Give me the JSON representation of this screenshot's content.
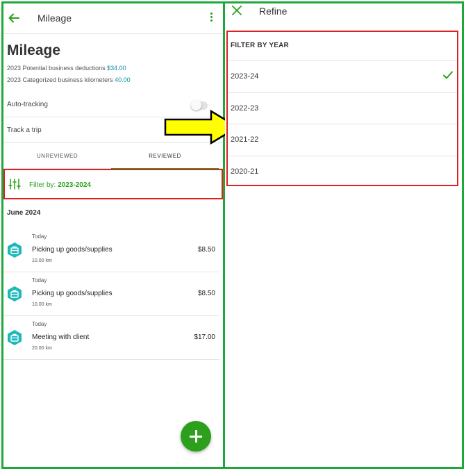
{
  "left": {
    "topbar_title": "Mileage",
    "page_title": "Mileage",
    "summary": {
      "deductions_label": "2023 Potential business deductions",
      "deductions_value": "$34.00",
      "km_label": "2023 Categorized business kilometers",
      "km_value": "40.00"
    },
    "auto_tracking_label": "Auto-tracking",
    "auto_tracking_on": false,
    "track_trip_label": "Track a trip",
    "tabs": {
      "unreviewed": "UNREVIEWED",
      "reviewed": "REVIEWED"
    },
    "filter": {
      "label": "Filter by:",
      "value": "2023-2024"
    },
    "month": "June 2024",
    "trips": [
      {
        "date": "Today",
        "name": "Picking up goods/supplies",
        "distance": "10.00 km",
        "amount": "$8.50"
      },
      {
        "date": "Today",
        "name": "Picking up goods/supplies",
        "distance": "10.00 km",
        "amount": "$8.50"
      },
      {
        "date": "Today",
        "name": "Meeting with client",
        "distance": "20.00 km",
        "amount": "$17.00"
      }
    ]
  },
  "right": {
    "title": "Refine",
    "filter_header": "FILTER BY YEAR",
    "years": [
      "2023-24",
      "2022-23",
      "2021-22",
      "2020-21"
    ],
    "selected_year": "2023-24"
  },
  "colors": {
    "brand_green": "#2ca01c",
    "teal": "#0b8ea8",
    "highlight_red": "#e02020",
    "frame_green": "#1fa83a",
    "arrow_yellow": "#ffff00"
  },
  "icons": {
    "back": "arrow-left-icon",
    "menu": "kebab-menu-icon",
    "filter": "sliders-icon",
    "trip": "briefcase-hexagon-icon",
    "add": "plus-icon",
    "close": "close-icon",
    "check": "checkmark-icon"
  }
}
